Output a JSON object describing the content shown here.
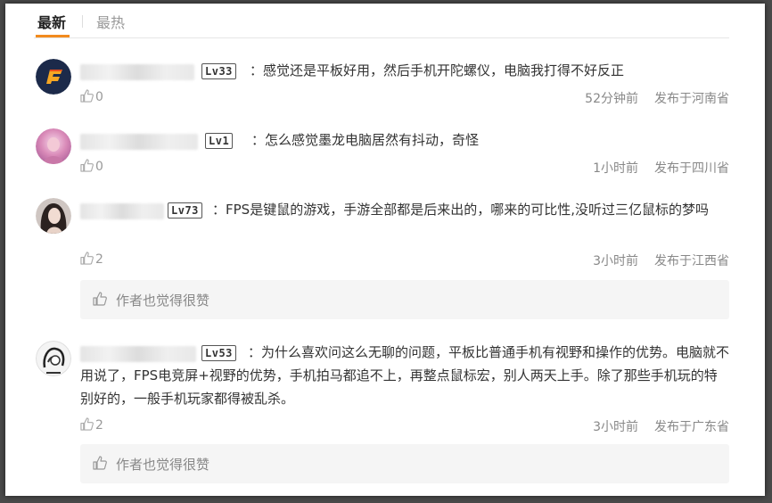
{
  "tabs": [
    {
      "label": "最新"
    },
    {
      "label": "最热"
    }
  ],
  "comments": [
    {
      "level": "Lv33",
      "text": "：感觉还是平板好用，然后手机开陀螺仪，电脑我打得不好反正",
      "likes": "0",
      "time": "52分钟前",
      "location": "发布于河南省"
    },
    {
      "level": "Lv1",
      "text": "：怎么感觉墨龙电脑居然有抖动，奇怪",
      "likes": "0",
      "time": "1小时前",
      "location": "发布于四川省"
    },
    {
      "level": "Lv73",
      "text": "：FPS是键鼠的游戏，手游全部都是后来出的，哪来的可比性,没听过三亿鼠标的梦吗",
      "likes": "2",
      "time": "3小时前",
      "location": "发布于江西省",
      "reply": "作者也觉得很赞"
    },
    {
      "level": "Lv53",
      "text": "：为什么喜欢问这么无聊的问题，平板比普通手机有视野和操作的优势。电脑就不用说了，FPS电竞屏+视野的优势，手机拍马都追不上，再整点鼠标宏，别人两天上手。除了那些手机玩的特别好的，一般手机玩家都得被乱杀。",
      "likes": "2",
      "time": "3小时前",
      "location": "发布于广东省",
      "reply": "作者也觉得很赞"
    }
  ],
  "colors": {
    "accent": "#f28b1e",
    "text": "#333333",
    "muted": "#999999"
  },
  "icons": {
    "like": "thumbs-up-icon"
  }
}
